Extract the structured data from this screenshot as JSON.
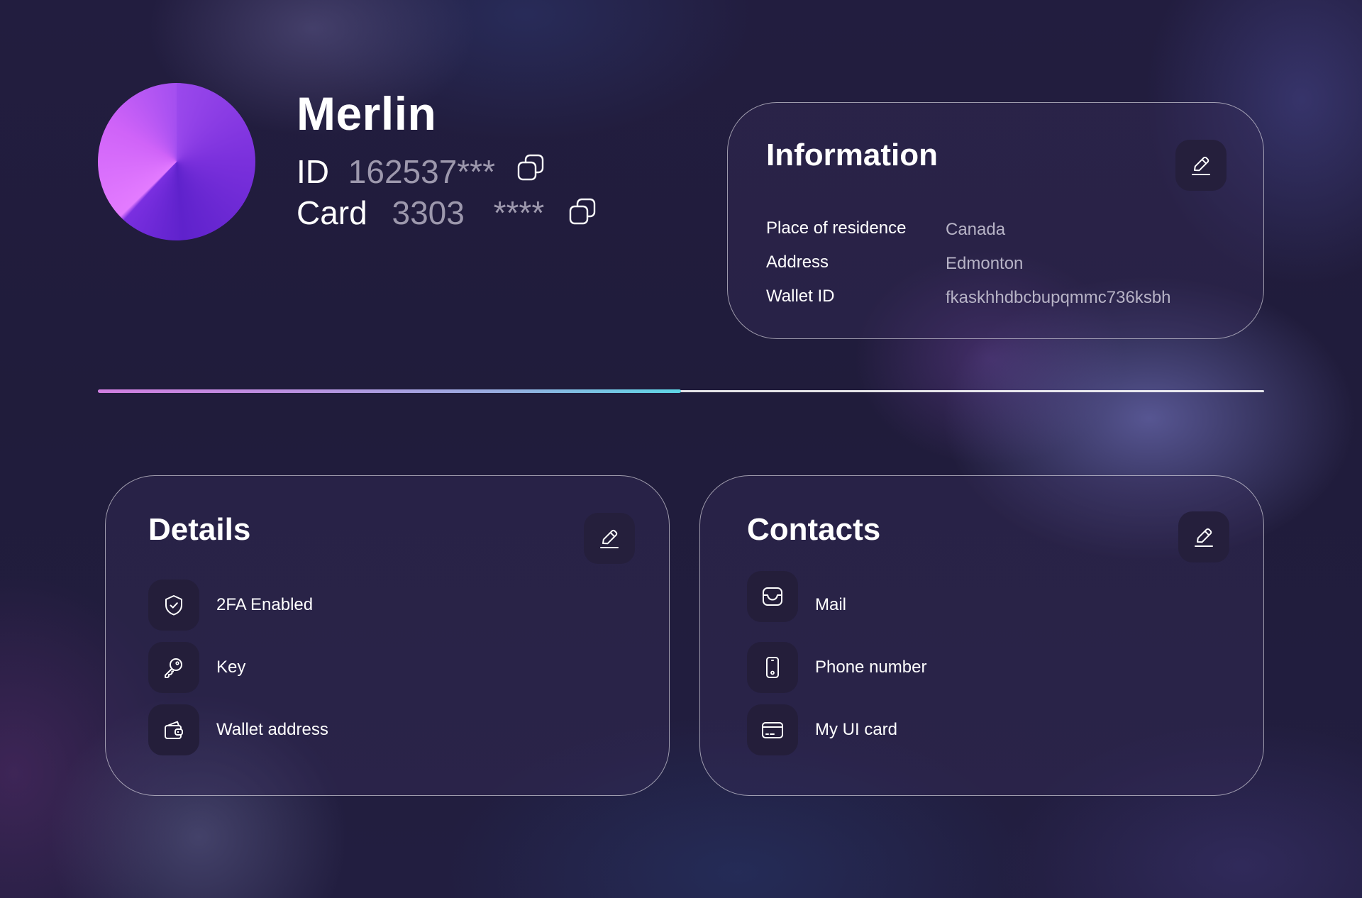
{
  "profile": {
    "name": "Merlin",
    "id_label": "ID",
    "id_value": "162537***",
    "card_label": "Card",
    "card_number": "3303",
    "card_mask": "****"
  },
  "information": {
    "title": "Information",
    "rows": [
      {
        "label": "Place of residence",
        "value": "Canada"
      },
      {
        "label": "Address",
        "value": "Edmonton"
      },
      {
        "label": "Wallet ID",
        "value": "fkaskhhdbcbupqmmc736ksbh"
      }
    ]
  },
  "progress": {
    "fraction": 0.5,
    "colors": {
      "start": "#d07ee0",
      "end": "#5ed6e6",
      "track": "#ffffff"
    }
  },
  "details": {
    "title": "Details",
    "items": [
      {
        "label": "2FA Enabled",
        "icon": "shield-check-icon"
      },
      {
        "label": "Key",
        "icon": "key-icon"
      },
      {
        "label": "Wallet address",
        "icon": "wallet-icon"
      }
    ]
  },
  "contacts": {
    "title": "Contacts",
    "items": [
      {
        "label": "Mail",
        "icon": "mail-inbox-icon"
      },
      {
        "label": "Phone number",
        "icon": "phone-icon"
      },
      {
        "label": "My UI card",
        "icon": "credit-card-icon"
      }
    ]
  },
  "colors": {
    "background": "#221d3d",
    "avatar_light": "#e37bff",
    "avatar_dark": "#5f22cc",
    "muted_text": "#9d98ad",
    "icon_tile": "#241e3a"
  }
}
